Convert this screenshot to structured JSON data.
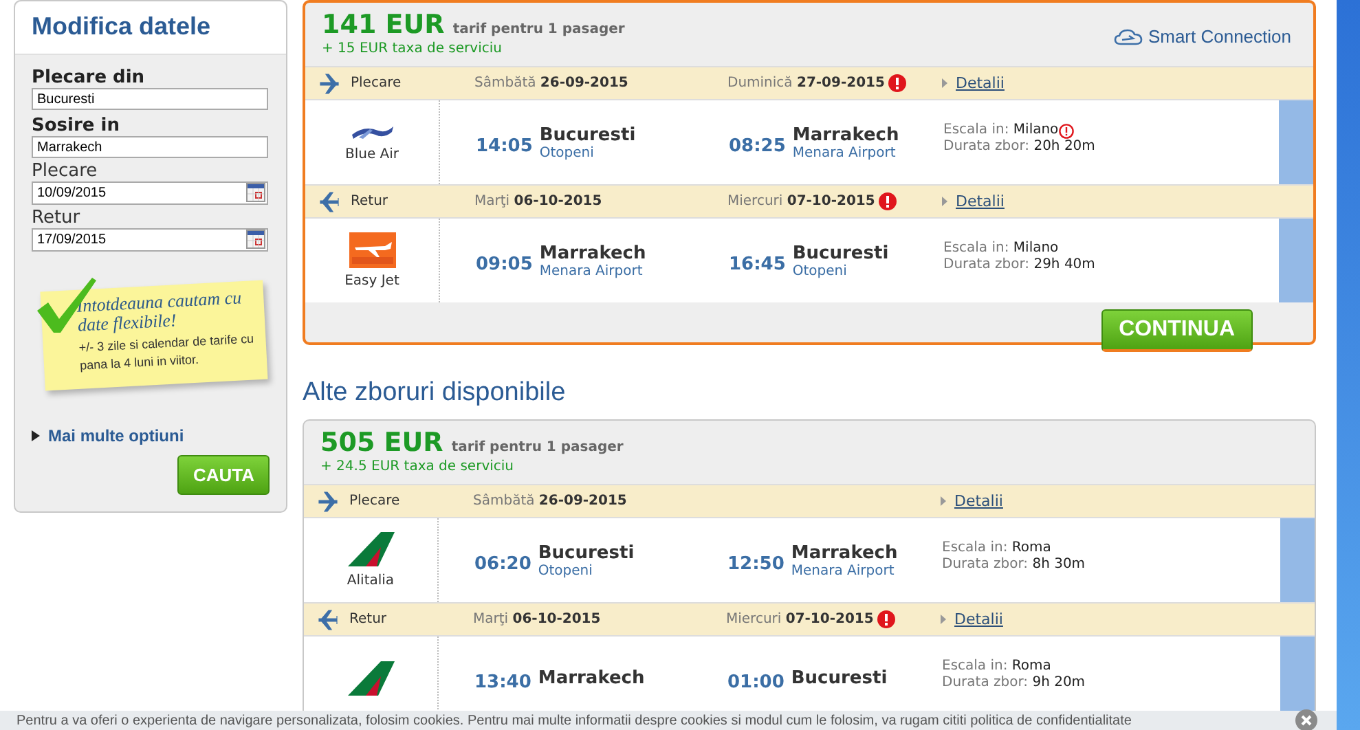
{
  "sidebar": {
    "title": "Modifica datele",
    "fields": [
      {
        "kind": "place",
        "label": "Plecare din",
        "value": "Bucuresti"
      },
      {
        "kind": "place",
        "label": "Sosire in",
        "value": "Marrakech"
      },
      {
        "kind": "date",
        "label": "Plecare",
        "value": "10/09/2015"
      },
      {
        "kind": "date",
        "label": "Retur",
        "value": "17/09/2015"
      }
    ],
    "note": {
      "headline": "Intotdeauna cautam cu date flexibile!",
      "text": "+/- 3 zile si calendar de tarife cu pana la 4 luni in viitor."
    },
    "more_options": "Mai multe optiuni",
    "search_button": "CAUTA"
  },
  "offers": [
    {
      "selected": true,
      "price": "141 EUR",
      "fare_note": "tarif pentru 1 pasager",
      "fee": "+ 15 EUR taxa de serviciu",
      "badge": "Smart Connection",
      "button": "CONTINUA",
      "legs": [
        {
          "kind": "outbound",
          "direction": "Plecare",
          "dep_day": "Sâmbătă",
          "dep_date": "26-09-2015",
          "arr_day": "Duminică",
          "arr_date": "27-09-2015",
          "arr_warning": true,
          "details": "Detalii",
          "logo": {
            "kind": "blueair"
          },
          "airline": "Blue Air",
          "dep_time": "14:05",
          "dep_city": "Bucuresti",
          "dep_airport": "Otopeni",
          "arr_time": "08:25",
          "arr_city": "Marrakech",
          "arr_airport": "Menara Airport",
          "stopover_label": "Escala in:",
          "stopover": "Milano",
          "stopover_warning": true,
          "duration_label": "Durata zbor:",
          "duration": "20h 20m"
        },
        {
          "kind": "return",
          "direction": "Retur",
          "dep_day": "Marţi",
          "dep_date": "06-10-2015",
          "arr_day": "Miercuri",
          "arr_date": "07-10-2015",
          "arr_warning": true,
          "details": "Detalii",
          "logo": {
            "kind": "easyjet"
          },
          "airline": "Easy Jet",
          "dep_time": "09:05",
          "dep_city": "Marrakech",
          "dep_airport": "Menara Airport",
          "arr_time": "16:45",
          "arr_city": "Bucuresti",
          "arr_airport": "Otopeni",
          "stopover_label": "Escala in:",
          "stopover": "Milano",
          "stopover_warning": false,
          "duration_label": "Durata zbor:",
          "duration": "29h 40m"
        }
      ]
    },
    {
      "section_title": "Alte zboruri disponibile",
      "selected": false,
      "price": "505 EUR",
      "fare_note": "tarif pentru 1 pasager",
      "fee": "+ 24.5 EUR taxa de serviciu",
      "legs": [
        {
          "kind": "outbound",
          "direction": "Plecare",
          "dep_day": "Sâmbătă",
          "dep_date": "26-09-2015",
          "arr_warning": false,
          "details": "Detalii",
          "logo": {
            "kind": "alitalia"
          },
          "airline": "Alitalia",
          "dep_time": "06:20",
          "dep_city": "Bucuresti",
          "dep_airport": "Otopeni",
          "arr_time": "12:50",
          "arr_city": "Marrakech",
          "arr_airport": "Menara Airport",
          "stopover_label": "Escala in:",
          "stopover": "Roma",
          "stopover_warning": false,
          "duration_label": "Durata zbor:",
          "duration": "8h 30m"
        },
        {
          "kind": "return",
          "direction": "Retur",
          "dep_day": "Marţi",
          "dep_date": "06-10-2015",
          "arr_day": "Miercuri",
          "arr_date": "07-10-2015",
          "arr_warning": true,
          "details": "Detalii",
          "logo": {
            "kind": "alitalia"
          },
          "dep_time": "13:40",
          "dep_city": "Marrakech",
          "arr_time": "01:00",
          "arr_city": "Bucuresti",
          "stopover_label": "Escala in:",
          "stopover": "Roma",
          "stopover_warning": false,
          "duration_label": "Durata zbor:",
          "duration": "9h 20m"
        }
      ]
    }
  ],
  "cookie_bar": {
    "text": "Pentru a va oferi o experienta de navigare personalizata, folosim cookies. Pentru mai multe informatii despre cookies si modul cum le folosim, va rugam cititi politica de confidentialitate"
  }
}
